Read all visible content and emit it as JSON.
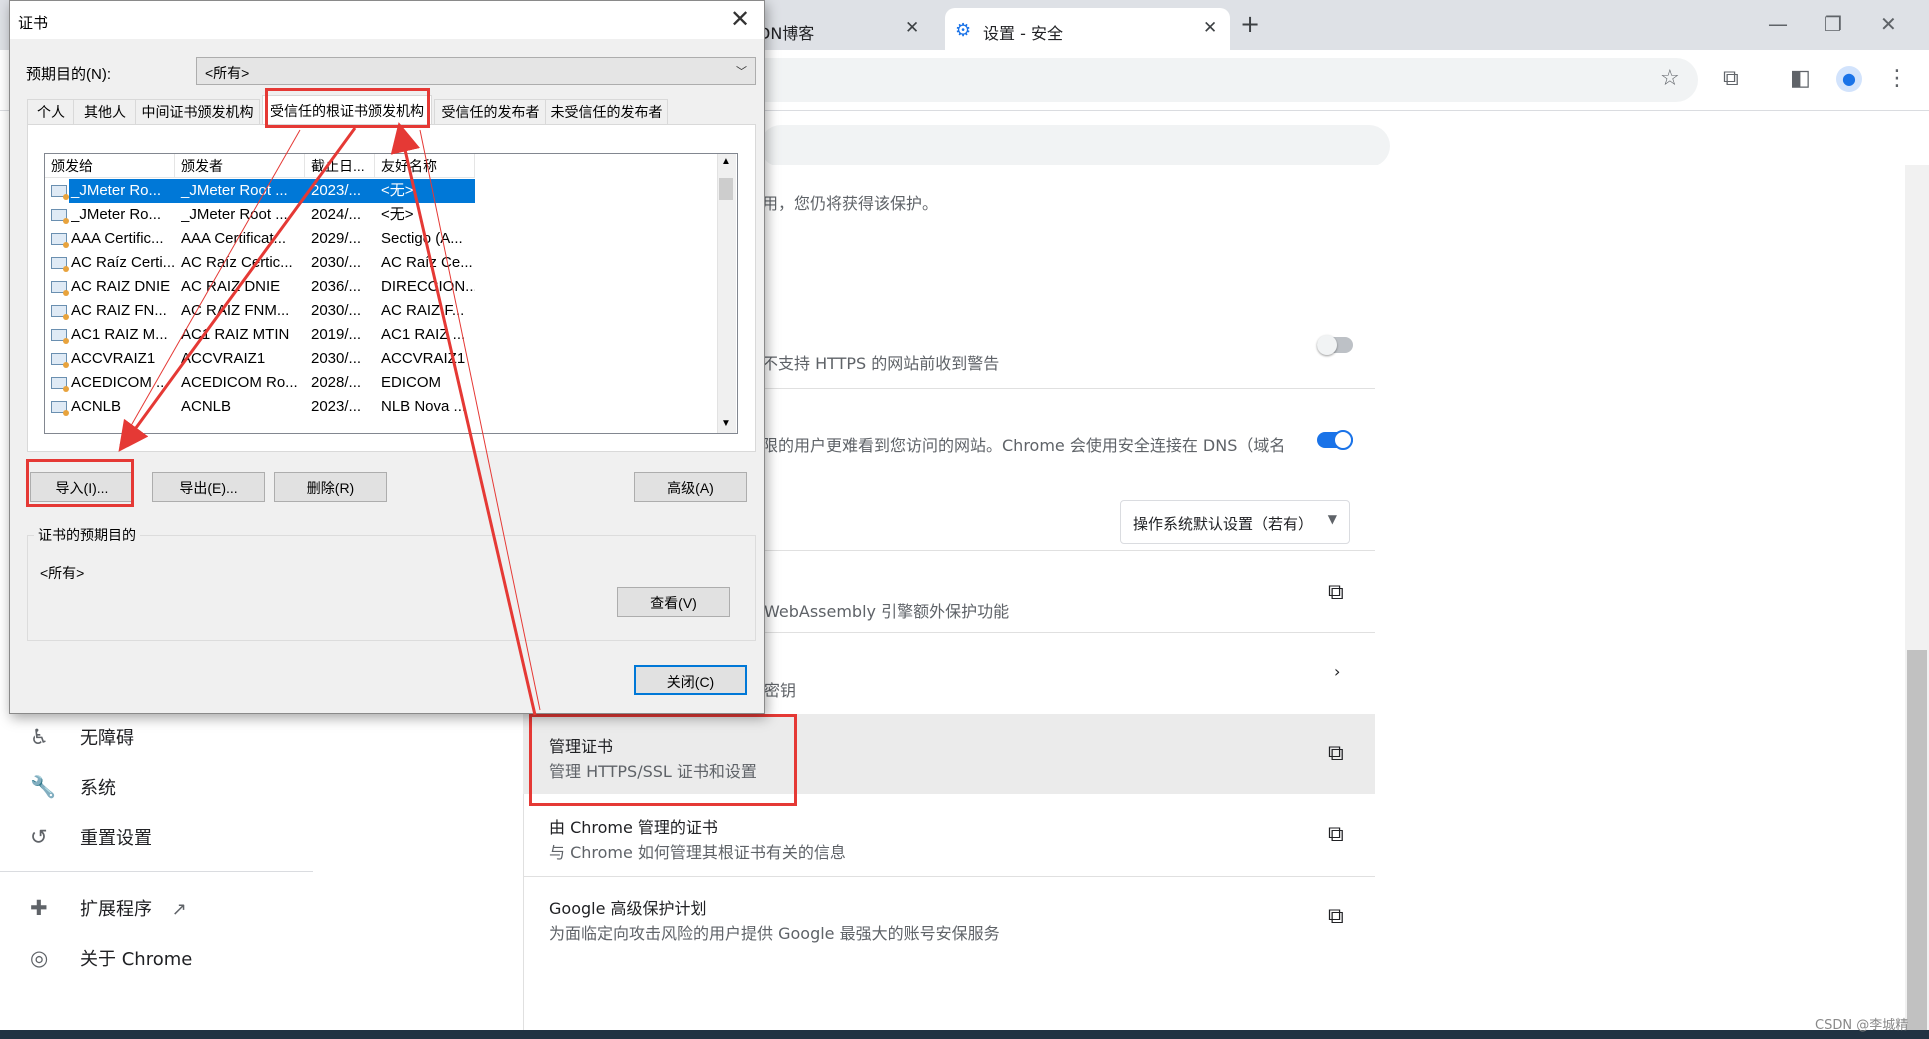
{
  "browser": {
    "tabs": [
      {
        "label": "DN博客",
        "active": false
      },
      {
        "label": "设置 - 安全",
        "active": true
      }
    ],
    "new_tab_symbol": "+",
    "close_symbol": "✕",
    "window_controls": {
      "minimize": "—",
      "restore": "❐",
      "close": "✕"
    },
    "toolbar_icons": [
      "star-icon",
      "extensions-icon",
      "side-panel-icon",
      "profile-icon",
      "menu-icon"
    ]
  },
  "sidebar": {
    "items": [
      {
        "label": "无障碍",
        "icon": "accessibility-icon"
      },
      {
        "label": "系统",
        "icon": "wrench-icon"
      },
      {
        "label": "重置设置",
        "icon": "reset-icon"
      },
      {
        "label": "扩展程序",
        "icon": "puzzle-icon"
      },
      {
        "label": "关于 Chrome",
        "icon": "chrome-icon"
      }
    ]
  },
  "settings": {
    "partial_desc_1": "用，您仍将获得该保护。",
    "https_warn": "不支持 HTTPS 的网站前收到警告",
    "https_toggle": false,
    "dns_desc": "限的用户更难看到您访问的网站。Chrome 会使用安全连接在 DNS（域名",
    "dns_toggle": true,
    "dns_select_value": "操作系统默认设置（若有）",
    "wasm_desc": "WebAssembly 引擎额外保护功能",
    "keys_desc": "密钥",
    "manage_certs_title": "管理证书",
    "manage_certs_desc": "管理 HTTPS/SSL 证书和设置",
    "chrome_certs_title": "由 Chrome 管理的证书",
    "chrome_certs_desc": "与 Chrome 如何管理其根证书有关的信息",
    "adv_protect_title": "Google 高级保护计划",
    "adv_protect_desc": "为面临定向攻击风险的用户提供 Google 最强大的账号安保服务"
  },
  "dialog": {
    "title": "证书",
    "close_symbol": "✕",
    "purpose_label": "预期目的(N):",
    "purpose_value": "<所有>",
    "tabs": [
      "个人",
      "其他人",
      "中间证书颁发机构",
      "受信任的根证书颁发机构",
      "受信任的发布者",
      "未受信任的发布者"
    ],
    "active_tab": "受信任的根证书颁发机构",
    "columns": [
      "颁发给",
      "颁发者",
      "截止日...",
      "友好名称"
    ],
    "rows": [
      [
        "_JMeter Ro...",
        "_JMeter Root ...",
        "2023/...",
        "<无>"
      ],
      [
        "_JMeter Ro...",
        "_JMeter Root ...",
        "2024/...",
        "<无>"
      ],
      [
        "AAA Certific...",
        "AAA Certificat...",
        "2029/...",
        "Sectigo (A..."
      ],
      [
        "AC Raíz Certi...",
        "AC Raíz Certic...",
        "2030/...",
        "AC Raíz Ce..."
      ],
      [
        "AC RAIZ DNIE",
        "AC RAIZ DNIE",
        "2036/...",
        "DIRECCION..."
      ],
      [
        "AC RAIZ FN...",
        "AC RAIZ FNM...",
        "2030/...",
        "AC RAIZ F..."
      ],
      [
        "AC1 RAIZ M...",
        "AC1 RAIZ MTIN",
        "2019/...",
        "AC1 RAIZ ..."
      ],
      [
        "ACCVRAIZ1",
        "ACCVRAIZ1",
        "2030/...",
        "ACCVRAIZ1"
      ],
      [
        "ACEDICOM ...",
        "ACEDICOM Ro...",
        "2028/...",
        "EDICOM"
      ],
      [
        "ACNLB",
        "ACNLB",
        "2023/...",
        "NLB Nova ..."
      ]
    ],
    "selected_row": 0,
    "buttons": {
      "import": "导入(I)...",
      "export": "导出(E)...",
      "remove": "删除(R)",
      "advanced": "高级(A)",
      "view": "查看(V)",
      "close": "关闭(C)"
    },
    "cert_purposes_label": "证书的预期目的",
    "cert_purposes_value": "<所有>"
  },
  "watermark": "CSDN @李城精",
  "colors": {
    "annotation": "#e53935",
    "selection": "#0078d7",
    "toggle_on": "#1a73e8"
  }
}
